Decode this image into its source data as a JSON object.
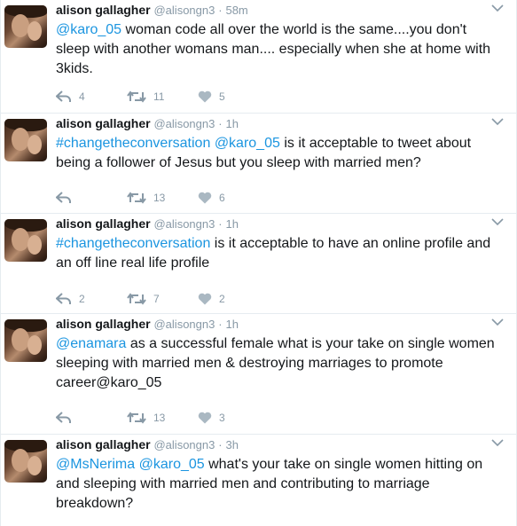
{
  "icons": {
    "reply": "reply-arrow-icon",
    "retweet": "retweet-icon",
    "like": "heart-icon",
    "more": "chevron-down-icon"
  },
  "colors": {
    "link": "#1b95e0",
    "muted": "#8899a6",
    "text": "#14171a",
    "divider": "#e6ecf0"
  },
  "tweets": [
    {
      "name": "alison gallagher",
      "handle": "@alisongn3",
      "sep": "·",
      "time": "58m",
      "segments": [
        {
          "t": "@karo_05",
          "link": true
        },
        {
          "t": " woman code all over the world is the same....you don't sleep with another womans man.... especially when she at home with 3kids.",
          "link": false
        }
      ],
      "replies": "4",
      "retweets": "11",
      "likes": "5"
    },
    {
      "name": "alison gallagher",
      "handle": "@alisongn3",
      "sep": "·",
      "time": "1h",
      "segments": [
        {
          "t": "#changetheconversation",
          "link": true
        },
        {
          "t": " ",
          "link": false
        },
        {
          "t": "@karo_05",
          "link": true
        },
        {
          "t": " is it acceptable to tweet about being a follower of Jesus but you sleep with married men?",
          "link": false
        }
      ],
      "replies": "",
      "retweets": "13",
      "likes": "6"
    },
    {
      "name": "alison gallagher",
      "handle": "@alisongn3",
      "sep": "·",
      "time": "1h",
      "segments": [
        {
          "t": "#changetheconversation",
          "link": true
        },
        {
          "t": " is it acceptable to have an online profile and an off line real life profile",
          "link": false
        }
      ],
      "replies": "2",
      "retweets": "7",
      "likes": "2"
    },
    {
      "name": "alison gallagher",
      "handle": "@alisongn3",
      "sep": "·",
      "time": "1h",
      "segments": [
        {
          "t": "@enamara",
          "link": true
        },
        {
          "t": " as a successful female what is your take on single women sleeping with married men & destroying marriages to promote career@karo_05",
          "link": false
        }
      ],
      "replies": "",
      "retweets": "13",
      "likes": "3"
    },
    {
      "name": "alison gallagher",
      "handle": "@alisongn3",
      "sep": "·",
      "time": "3h",
      "segments": [
        {
          "t": "@MsNerima",
          "link": true
        },
        {
          "t": " ",
          "link": false
        },
        {
          "t": "@karo_05",
          "link": true
        },
        {
          "t": " what's your take on single women hitting on and sleeping with married men and contributing to marriage breakdown?",
          "link": false
        }
      ],
      "replies": "",
      "retweets": "",
      "likes": ""
    }
  ]
}
